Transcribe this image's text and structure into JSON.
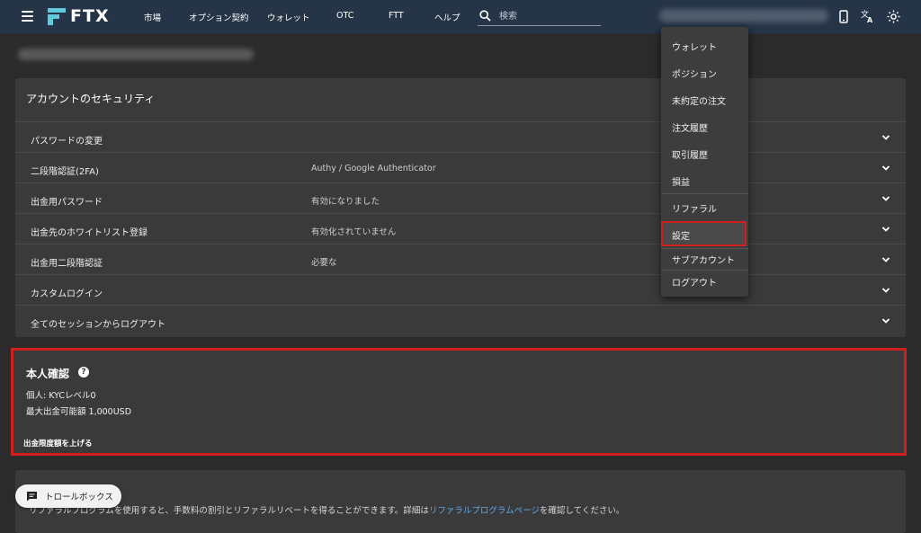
{
  "header": {
    "logo": "FTX",
    "nav": [
      "市場",
      "オプション契約",
      "ウォレット",
      "OTC",
      "FTT",
      "ヘルプ"
    ],
    "search_placeholder": "検索"
  },
  "security": {
    "title": "アカウントのセキュリティ",
    "rows": [
      {
        "label": "パスワードの変更",
        "value": ""
      },
      {
        "label": "二段階認証(2FA)",
        "value": "Authy / Google Authenticator"
      },
      {
        "label": "出金用パスワード",
        "value": "有効になりました"
      },
      {
        "label": "出金先のホワイトリスト登録",
        "value": "有効化されていません"
      },
      {
        "label": "出金用二段階認証",
        "value": "必要な"
      },
      {
        "label": "カスタムログイン",
        "value": ""
      },
      {
        "label": "全てのセッションからログアウト",
        "value": ""
      }
    ]
  },
  "identity": {
    "title": "本人確認",
    "level": "個人: KYCレベル0",
    "limit": "最大出金可能額 1,000USD",
    "raise_link": "出金限度額を上げる"
  },
  "referral": {
    "text_before": "リファラルプログラムを使用すると、手数料の割引とリファラルリベートを得ることができます。詳細は",
    "link": "リファラルプログラムページ",
    "text_after": "を確認してください。"
  },
  "trollbox": {
    "label": "トロールボックス"
  },
  "menu": {
    "items": [
      "ウォレット",
      "ポジション",
      "未約定の注文",
      "注文履歴",
      "取引履歴",
      "損益",
      "リファラル",
      "設定",
      "サブアカウント",
      "ログアウト"
    ],
    "highlighted": "設定"
  },
  "colors": {
    "topbar": "#253447",
    "background": "#2b2b2b",
    "card": "#3a3a3a",
    "highlight_border": "#d11e1e",
    "link": "#5da9f0"
  }
}
